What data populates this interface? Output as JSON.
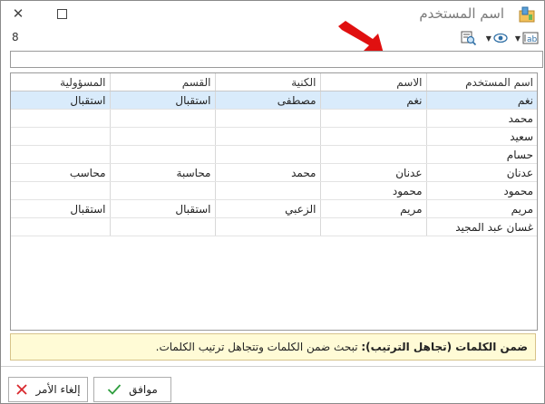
{
  "window": {
    "title": "اسم المستخدم"
  },
  "toolbar": {
    "count": "8"
  },
  "search": {
    "value": "",
    "placeholder": ""
  },
  "table": {
    "columns": [
      "اسم المستخدم",
      "الاسم",
      "الكنية",
      "القسم",
      "المسؤولية"
    ],
    "rows": [
      [
        "نغم",
        "نغم",
        "مصطفى",
        "استقبال",
        "استقبال"
      ],
      [
        "محمد",
        "",
        "",
        "",
        ""
      ],
      [
        "سعيد",
        "",
        "",
        "",
        ""
      ],
      [
        "حسام",
        "",
        "",
        "",
        ""
      ],
      [
        "عدنان",
        "عدنان",
        "محمد",
        "محاسبة",
        "محاسب"
      ],
      [
        "محمود",
        "محمود",
        "",
        "",
        ""
      ],
      [
        "مريم",
        "مريم",
        "الزعبي",
        "استقبال",
        "استقبال"
      ],
      [
        "غسان عبد المجيد",
        "",
        "",
        "",
        ""
      ]
    ]
  },
  "info": {
    "bold": "ضمن الكلمات (تجاهل الترتيب):",
    "text": " تبحث ضمن الكلمات وتتجاهل ترتيب الكلمات."
  },
  "buttons": {
    "ok": "موافق",
    "cancel": "إلغاء الأمر"
  },
  "colors": {
    "selected_row": "#d9ebfb",
    "info_bg": "#fffbd6",
    "arrow": "#e01010",
    "ok_check": "#2e9e3e",
    "cancel_x": "#d9262c"
  }
}
